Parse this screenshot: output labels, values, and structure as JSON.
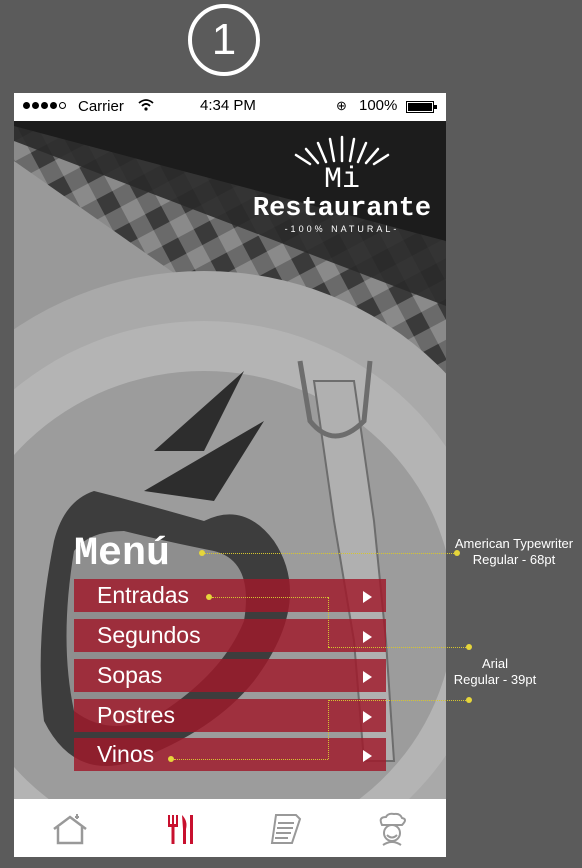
{
  "step_number": "1",
  "status_bar": {
    "carrier": "Carrier",
    "time": "4:34 PM",
    "battery": "100%",
    "signal_icon": "signal-dots-icon",
    "wifi_icon": "wifi-icon",
    "lock_icon": "orientation-lock-icon",
    "battery_icon": "battery-icon"
  },
  "logo": {
    "line1": "Mi",
    "line2": "Restaurante",
    "tagline": "-100% NATURAL-"
  },
  "menu": {
    "title": "Menú",
    "items": [
      {
        "label": "Entradas"
      },
      {
        "label": "Segundos"
      },
      {
        "label": "Sopas"
      },
      {
        "label": "Postres"
      },
      {
        "label": "Vinos"
      }
    ],
    "item_color": "#a0182a"
  },
  "tabbar": {
    "tabs": [
      {
        "icon": "home-icon",
        "active": false
      },
      {
        "icon": "fork-knife-icon",
        "active": true
      },
      {
        "icon": "document-icon",
        "active": false
      },
      {
        "icon": "chef-icon",
        "active": false
      }
    ],
    "active_color": "#c8102e"
  },
  "annotations": {
    "title_font": "American Typewriter\nRegular - 68pt",
    "item_font": "Arial\nRegular - 39pt"
  }
}
